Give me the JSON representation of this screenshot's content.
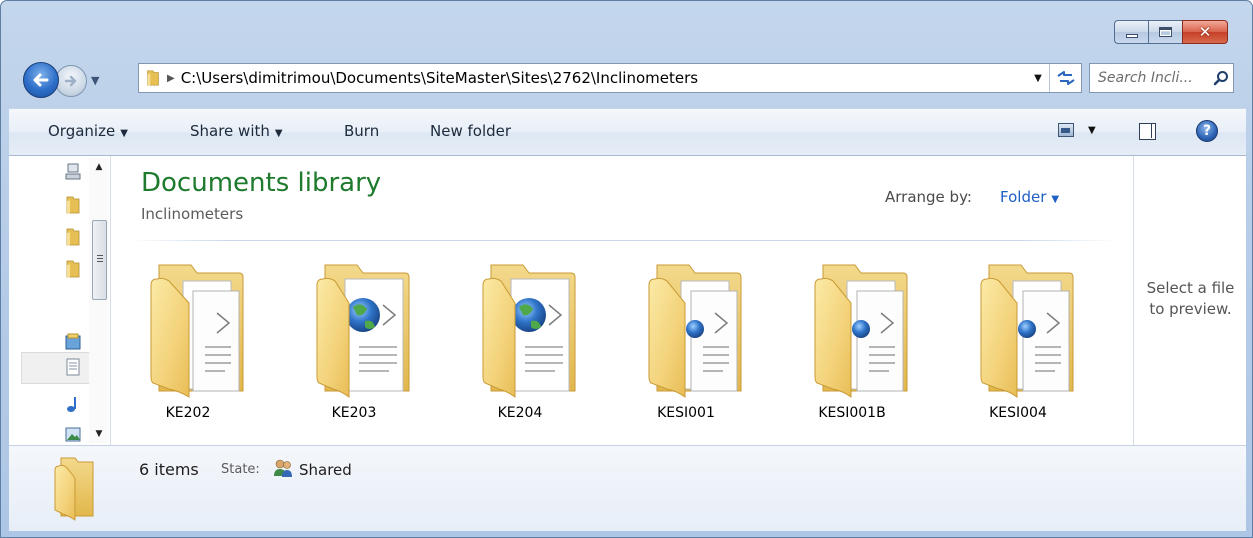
{
  "window": {
    "caption_buttons": {
      "minimize_icon": "minimize-icon",
      "maximize_icon": "maximize-icon",
      "close_icon": "close-icon"
    }
  },
  "navigation": {
    "back_icon": "arrow-left-icon",
    "forward_icon": "arrow-right-icon",
    "history_icon": "chevron-down-icon"
  },
  "address_bar": {
    "path": "C:\\Users\\dimitrimou\\Documents\\SiteMaster\\Sites\\2762\\Inclinometers",
    "folder_icon": "folder-icon",
    "refresh_icon": "refresh-icon"
  },
  "search": {
    "placeholder": "Search Incli...",
    "icon": "search-icon"
  },
  "command_bar": {
    "organize": "Organize",
    "share_with": "Share with",
    "burn": "Burn",
    "new_folder": "New folder",
    "views_icon": "views-icon",
    "preview_pane_icon": "preview-pane-icon",
    "help_icon": "help-icon"
  },
  "library": {
    "title": "Documents library",
    "subtitle": "Inclinometers",
    "arrange_by_label": "Arrange by:",
    "arrange_by_value": "Folder"
  },
  "items": [
    {
      "label": "KE202",
      "icon": "folder-documents-icon"
    },
    {
      "label": "KE203",
      "icon": "folder-web-icon"
    },
    {
      "label": "KE204",
      "icon": "folder-web-icon"
    },
    {
      "label": "KESI001",
      "icon": "folder-documents-icon"
    },
    {
      "label": "KESI001B",
      "icon": "folder-documents-icon"
    },
    {
      "label": "KESI004",
      "icon": "folder-documents-icon"
    }
  ],
  "preview_pane": {
    "line1": "Select a file",
    "line2": "to preview."
  },
  "details": {
    "count": "6 items",
    "state_label": "State:",
    "state_value": "Shared",
    "state_icon": "shared-users-icon"
  },
  "colors": {
    "library_title": "#1e7a2c",
    "link_blue": "#1e60c4",
    "close_red": "#c6402a"
  }
}
